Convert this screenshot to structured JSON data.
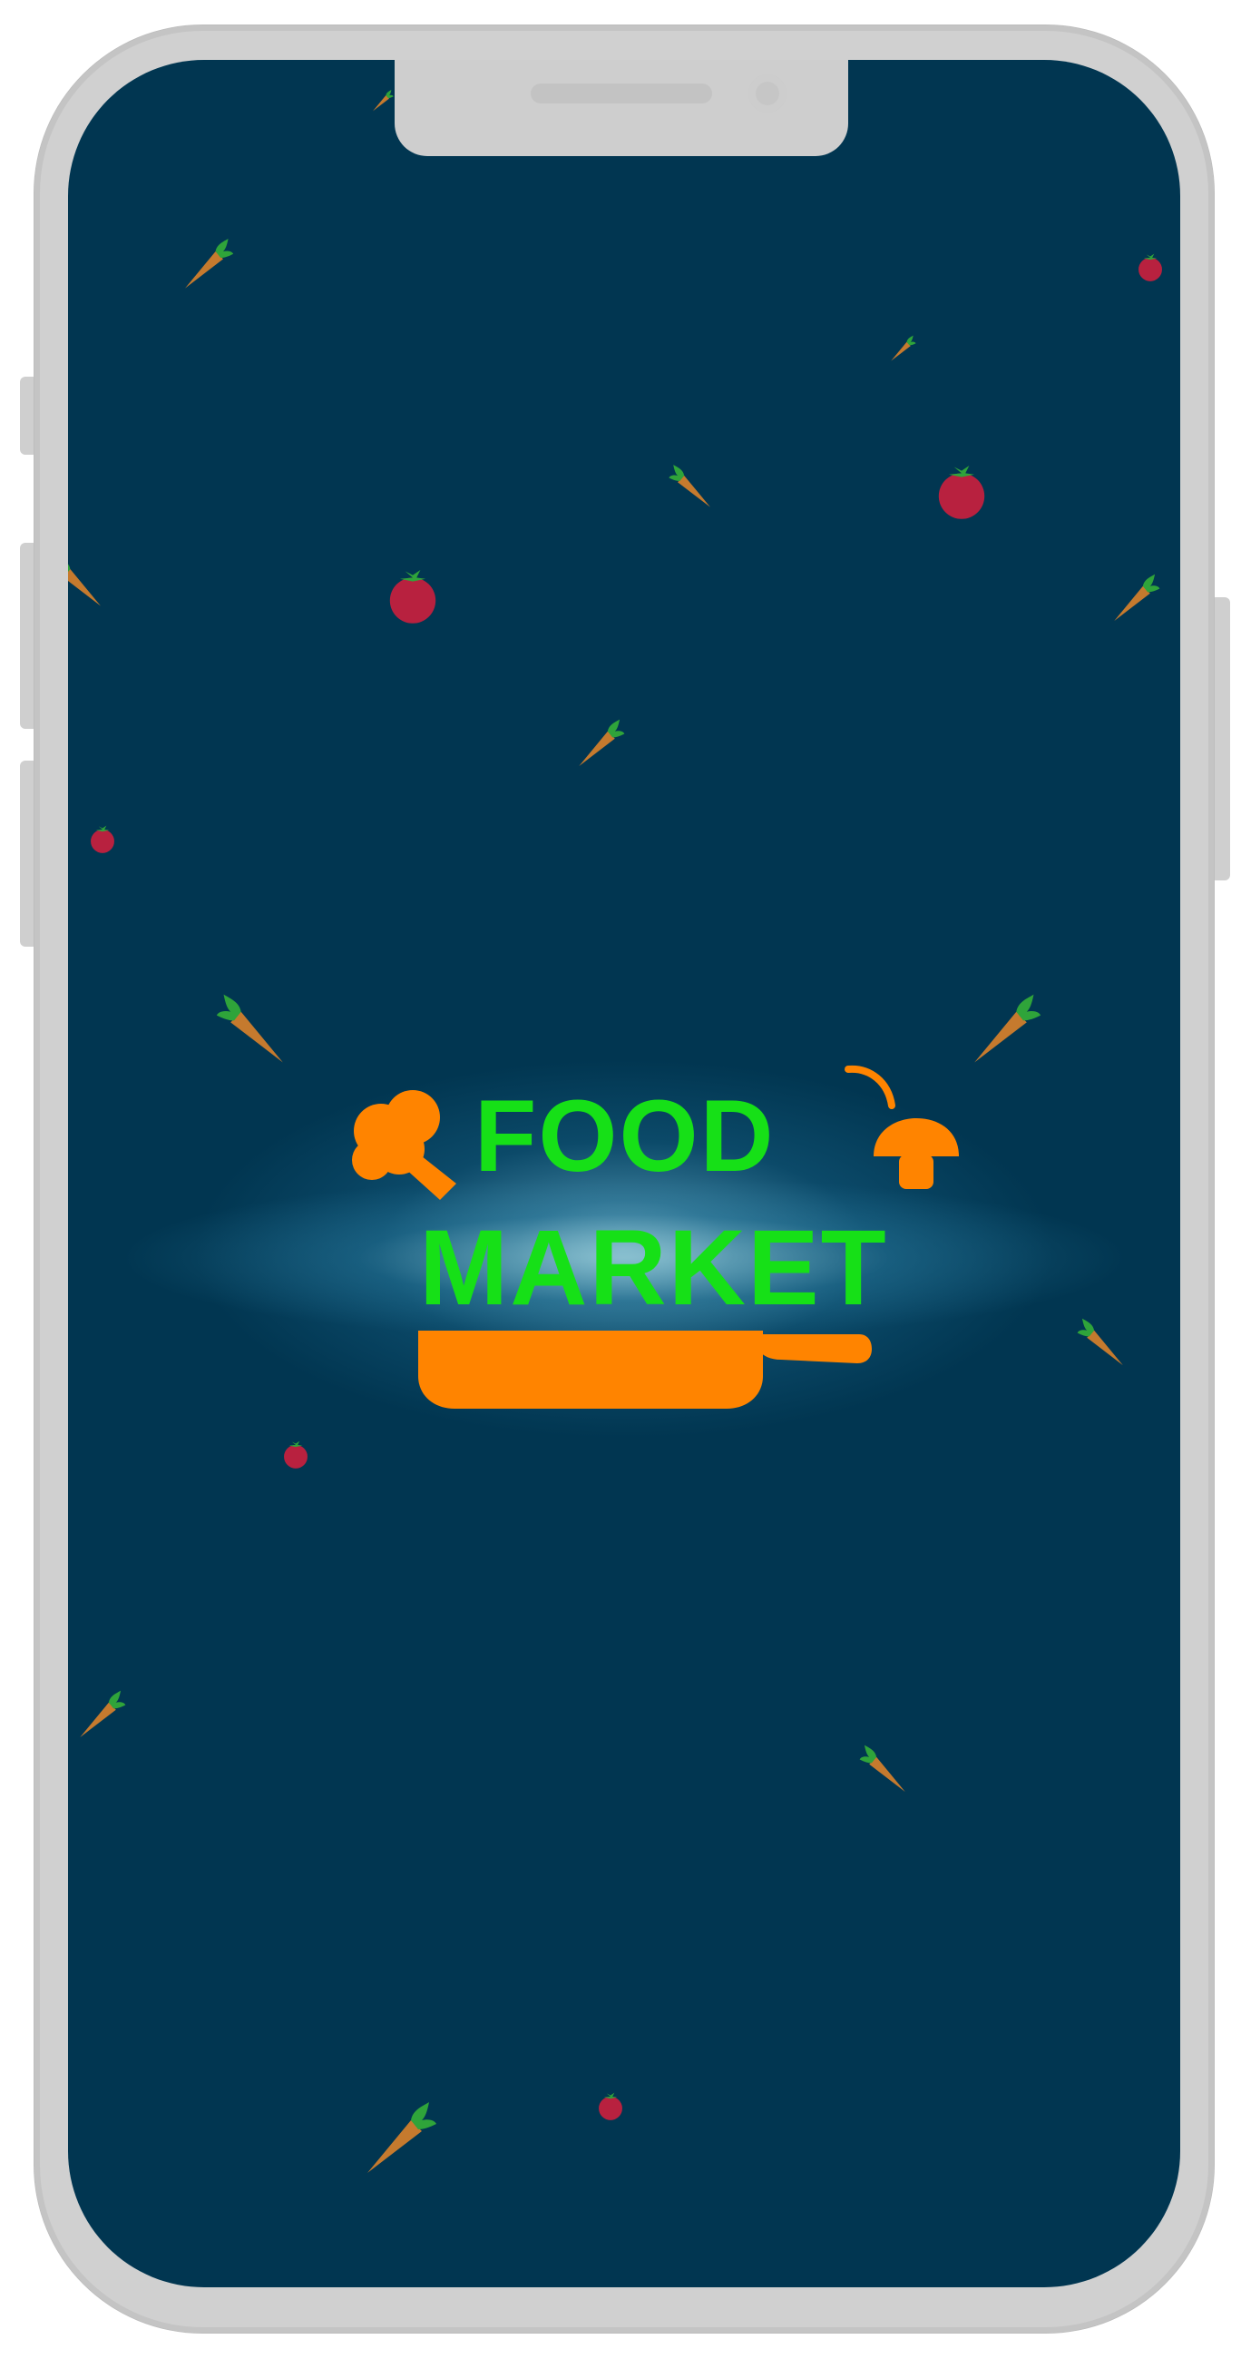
{
  "app": {
    "logo_line1": "FOOD",
    "logo_line2": "MARKET"
  },
  "colors": {
    "background": "#013651",
    "logo_text": "#16e017",
    "logo_orange": "#ff8400",
    "carrot": "#c57a2e",
    "carrot_leaf": "#2fa43a",
    "tomato": "#b8213f",
    "frame": "#d0d0d0"
  },
  "icons": [
    "carrot-icon",
    "tomato-icon",
    "broccoli-icon",
    "mushroom-icon",
    "frying-pan-icon"
  ]
}
